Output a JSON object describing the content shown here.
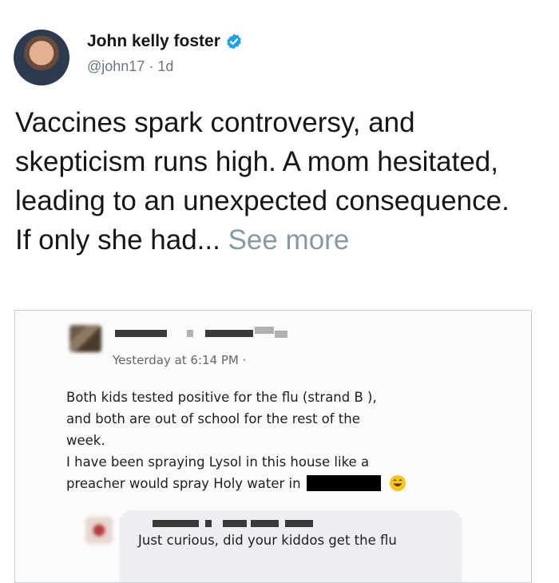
{
  "tweet": {
    "author_name": "John kelly foster",
    "handle": "@john17",
    "separator": "·",
    "age": "1d",
    "text": "Vaccines spark controversy, and skepticism runs high. A mom hesitated, leading to an unexpected consequence. If only she had...",
    "see_more": "See more"
  },
  "screenshot": {
    "timestamp": "Yesterday at 6:14 PM ·",
    "post_lines": [
      "Both kids tested positive for the flu (strand B ),",
      "and both are out of school for the rest of the",
      "week.",
      "I have been spraying Lysol in this house like a",
      "preacher would spray Holy water in"
    ],
    "comment_text": "Just curious, did your kiddos get the flu"
  },
  "colors": {
    "verified": "#1da1f2",
    "text": "#14171a",
    "secondary": "#657786",
    "see_more": "#8899a6"
  }
}
